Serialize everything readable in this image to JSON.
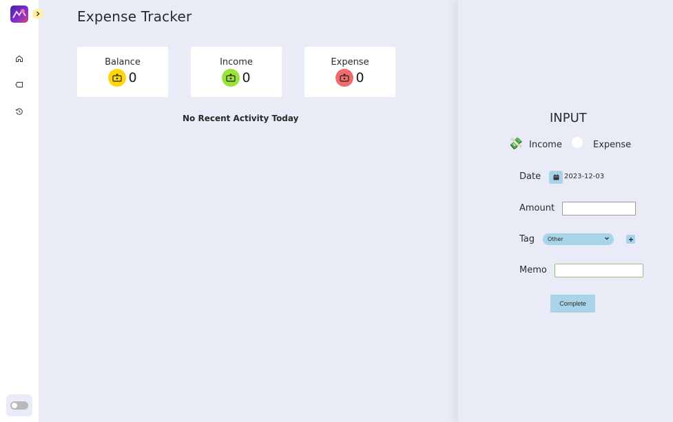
{
  "app": {
    "title": "Expense Tracker"
  },
  "sidebar": {
    "logo_icon": "app-logo",
    "expand_icon": "chevron-right-icon",
    "items": [
      {
        "name": "home",
        "icon": "home-icon"
      },
      {
        "name": "tags",
        "icon": "tag-icon"
      },
      {
        "name": "history",
        "icon": "history-icon"
      }
    ],
    "theme_toggle": "off"
  },
  "summary": {
    "cards": [
      {
        "label": "Balance",
        "value": "0",
        "icon": "wallet-icon",
        "color": "#ffd60a"
      },
      {
        "label": "Income",
        "value": "0",
        "icon": "wallet-icon",
        "color": "#9be33c"
      },
      {
        "label": "Expense",
        "value": "0",
        "icon": "wallet-icon",
        "color": "#f26b6b"
      }
    ],
    "empty_message": "No Recent Activity Today"
  },
  "form": {
    "title": "INPUT",
    "type_options": [
      {
        "label": "Income",
        "icon": "money-with-wings-icon",
        "selected": true
      },
      {
        "label": "Expense",
        "selected": false
      }
    ],
    "date": {
      "label": "Date",
      "value": "2023-12-03",
      "icon": "calendar-icon"
    },
    "amount": {
      "label": "Amount",
      "value": ""
    },
    "tag": {
      "label": "Tag",
      "selected": "Other",
      "add_icon": "plus-icon"
    },
    "memo": {
      "label": "Memo",
      "value": ""
    },
    "submit_label": "Complete"
  },
  "colors": {
    "accent": "#a9d3e8",
    "background": "#e9ebf6"
  }
}
